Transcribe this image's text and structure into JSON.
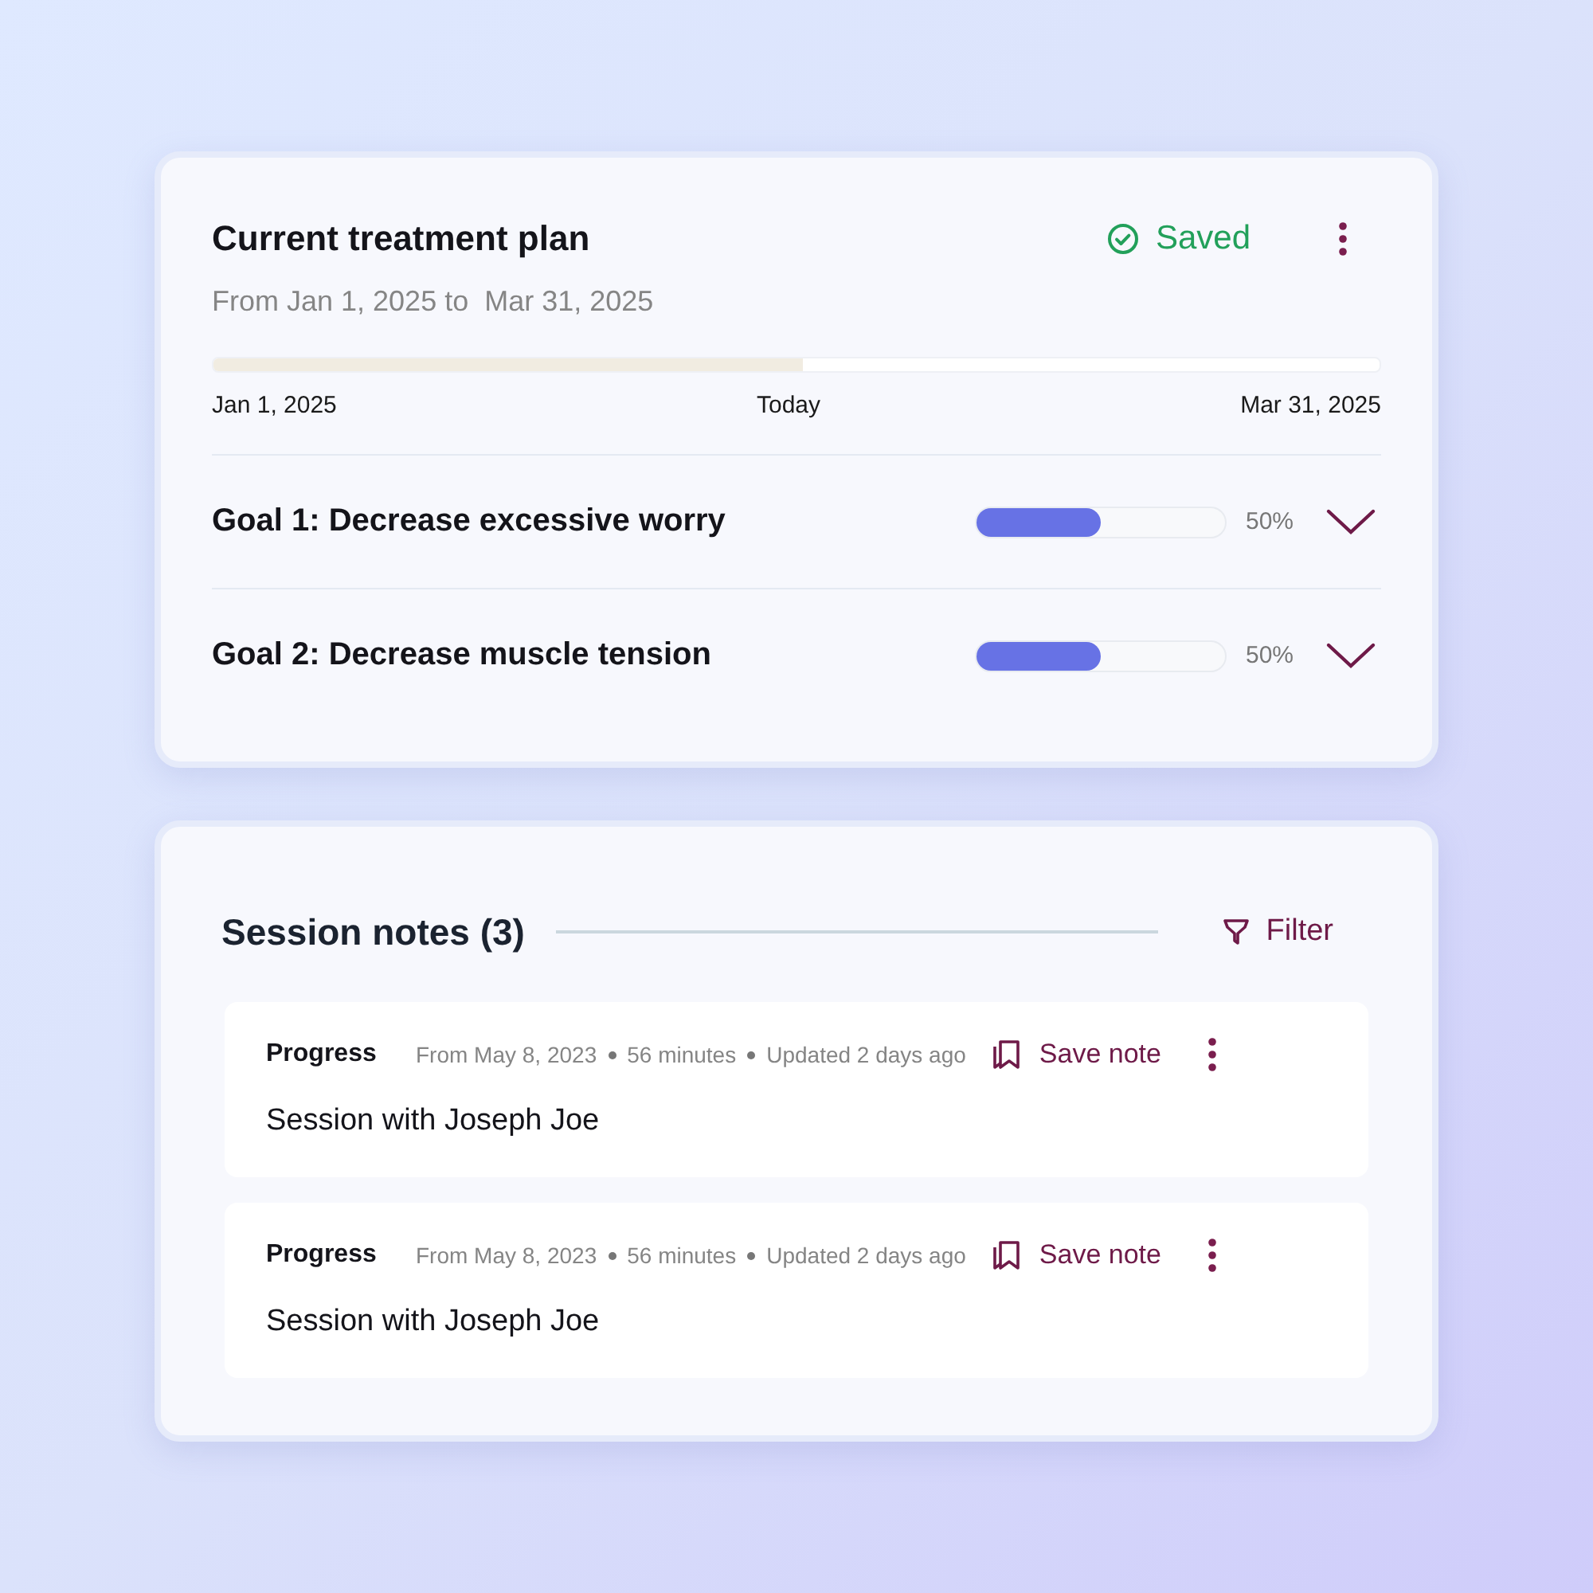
{
  "plan": {
    "title": "Current treatment plan",
    "status": "Saved",
    "range": "From Jan 1, 2025 to  Mar 31, 2025",
    "timeline": {
      "level": 0.505,
      "labels": [
        "Jan 1, 2025",
        "Today",
        "Mar 31, 2025"
      ]
    },
    "goals": [
      {
        "title": "Goal 1: Decrease excessive worry",
        "level": 0.5,
        "reading": "50%",
        "expanded": false
      },
      {
        "title": "Goal 2: Decrease muscle tension",
        "level": 0.5,
        "reading": "50%",
        "expanded": false
      }
    ]
  },
  "notes": {
    "title": "Session notes (3)",
    "filter": "Filter",
    "items": [
      {
        "type": "Progress",
        "meta": [
          "From May 8, 2023",
          "56 minutes",
          "Updated 2 days ago"
        ],
        "action": "Save note",
        "text": "Session with Joseph Joe"
      },
      {
        "type": "Progress",
        "meta": [
          "From May 8, 2023",
          "56 minutes",
          "Updated 2 days ago"
        ],
        "action": "Save note",
        "text": "Session with Joseph Joe"
      }
    ]
  }
}
